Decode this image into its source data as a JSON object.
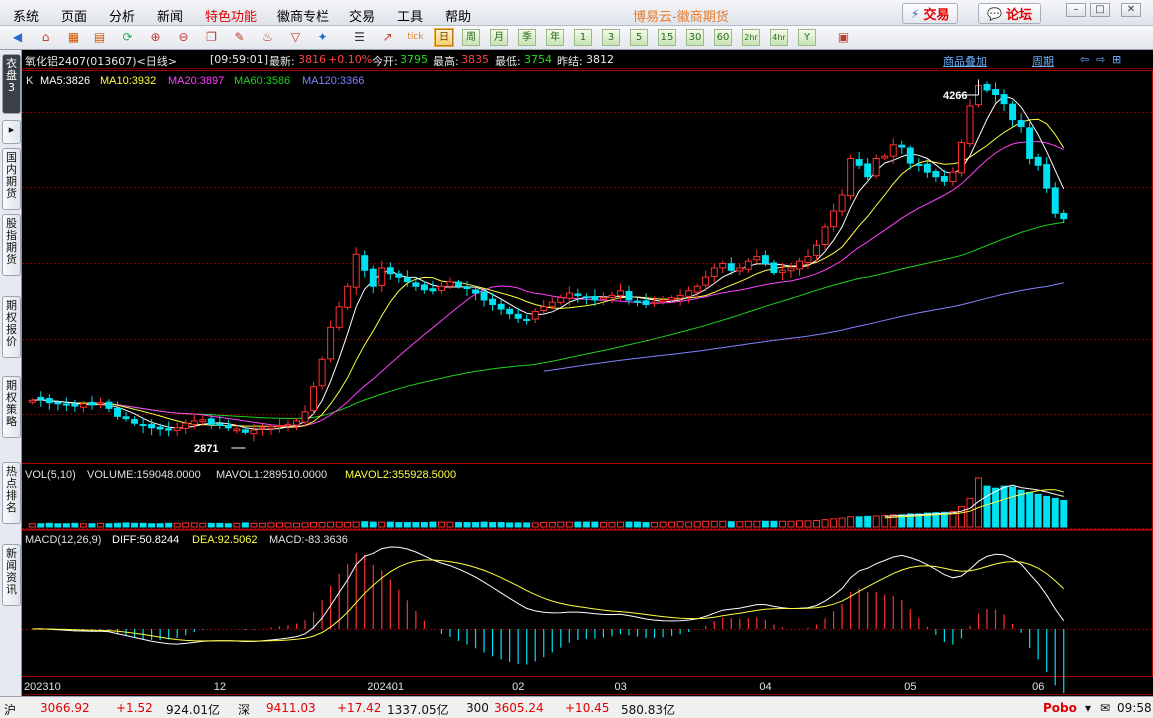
{
  "menu": {
    "items": [
      "系统",
      "页面",
      "分析",
      "新闻",
      "特色功能",
      "徽商专栏",
      "交易",
      "工具",
      "帮助"
    ],
    "app_title": "博易云-徽商期货",
    "trade_button": "交易",
    "forum_button": "论坛"
  },
  "toolbar": {
    "period_buttons": [
      "日",
      "周",
      "月",
      "季",
      "年",
      "1",
      "3",
      "5",
      "15",
      "30",
      "60",
      "2hr",
      "4hr",
      "Y"
    ],
    "selected_period": "日"
  },
  "sidebar": {
    "tabs": [
      "衣盘3",
      "国内期货",
      "股指期货",
      "期权报价",
      "期权策略",
      "热点排名",
      "新闻资讯"
    ]
  },
  "quote": {
    "symbol": "氧化铝2407(013607)<日线>",
    "time": "[09:59:01]",
    "latest_label": "最新:",
    "latest": "3816",
    "change": "+0.10%",
    "open_label": "今开:",
    "open": "3795",
    "high_label": "最高:",
    "high": "3835",
    "low_label": "最低:",
    "low": "3754",
    "prev_label": "昨结:",
    "prev": "3812",
    "overlay_link": "商品叠加",
    "period_link": "周期"
  },
  "indicators": {
    "k_label": "K",
    "ma5": "MA5:3826",
    "ma10": "MA10:3932",
    "ma20": "MA20:3897",
    "ma60": "MA60:3586",
    "ma120": "MA120:3366",
    "vol_label": "VOL(5,10)",
    "volume": "VOLUME:159048.0000",
    "mavol1": "MAVOL1:289510.0000",
    "mavol2": "MAVOL2:355928.5000",
    "macd_label": "MACD(12,26,9)",
    "diff": "DIFF:50.8244",
    "dea": "DEA:92.5062",
    "macd": "MACD:-83.3636"
  },
  "chart_data": {
    "type": "candlestick",
    "high_annotation": "4266",
    "low_annotation": "2871",
    "x_tick_labels": [
      "202310",
      "12",
      "202401",
      "02",
      "03",
      "04",
      "05",
      "06"
    ],
    "y_range": [
      2750,
      4380
    ],
    "closes": [
      3020,
      3025,
      3010,
      3005,
      3000,
      2995,
      3005,
      3000,
      3010,
      2985,
      2950,
      2940,
      2920,
      2910,
      2900,
      2895,
      2890,
      2900,
      2920,
      2930,
      2935,
      2915,
      2910,
      2900,
      2895,
      2880,
      2890,
      2900,
      2905,
      2910,
      2915,
      2930,
      2970,
      3080,
      3200,
      3340,
      3430,
      3520,
      3660,
      3590,
      3520,
      3600,
      3575,
      3560,
      3540,
      3520,
      3505,
      3500,
      3520,
      3540,
      3520,
      3510,
      3490,
      3460,
      3440,
      3420,
      3400,
      3380,
      3370,
      3410,
      3430,
      3450,
      3470,
      3490,
      3480,
      3470,
      3460,
      3470,
      3480,
      3500,
      3460,
      3450,
      3440,
      3450,
      3460,
      3470,
      3480,
      3500,
      3520,
      3560,
      3600,
      3620,
      3590,
      3600,
      3630,
      3650,
      3620,
      3580,
      3590,
      3600,
      3630,
      3650,
      3700,
      3780,
      3850,
      3920,
      4080,
      4050,
      4000,
      4080,
      4090,
      4140,
      4130,
      4060,
      4050,
      4020,
      4000,
      3980,
      4020,
      4150,
      4310,
      4400,
      4380,
      4360,
      4320,
      4250,
      4220,
      4080,
      4050,
      3950,
      3840,
      3816
    ],
    "volumes": [
      8,
      8,
      9,
      8,
      8,
      9,
      8,
      8,
      9,
      8,
      9,
      10,
      9,
      9,
      8,
      8,
      9,
      9,
      10,
      10,
      9,
      9,
      9,
      8,
      9,
      10,
      9,
      9,
      10,
      10,
      10,
      9,
      10,
      11,
      11,
      12,
      12,
      11,
      12,
      13,
      12,
      12,
      12,
      11,
      11,
      11,
      11,
      12,
      12,
      12,
      11,
      11,
      11,
      12,
      11,
      11,
      10,
      10,
      10,
      10,
      11,
      11,
      12,
      12,
      12,
      12,
      12,
      11,
      11,
      12,
      12,
      12,
      11,
      11,
      12,
      12,
      13,
      12,
      13,
      14,
      14,
      14,
      13,
      13,
      14,
      14,
      14,
      14,
      14,
      14,
      15,
      15,
      16,
      18,
      20,
      22,
      25,
      25,
      26,
      27,
      28,
      30,
      30,
      32,
      32,
      34,
      35,
      36,
      38,
      50,
      70,
      120,
      100,
      95,
      100,
      98,
      90,
      85,
      80,
      75,
      70,
      65
    ]
  },
  "status": {
    "sh_label": "沪",
    "sh_index": "3066.92",
    "sh_change": "+1.52",
    "sh_amount": "924.01亿",
    "sz_label": "深",
    "sz_index": "9411.03",
    "sz_change": "+17.42",
    "sz_amount": "1337.05亿",
    "i300_label": "300",
    "i300_index": "3605.24",
    "i300_change": "+10.45",
    "i300_amount": "580.83亿",
    "brand": "Pobo",
    "clock": "09:58"
  },
  "colors": {
    "up": "#ff3030",
    "down": "#00e0f0",
    "ma5": "#ffffff",
    "ma10": "#ffff40",
    "ma20": "#ff40ff",
    "ma60": "#20d020",
    "ma120": "#8080ff",
    "grid": "#800000"
  }
}
